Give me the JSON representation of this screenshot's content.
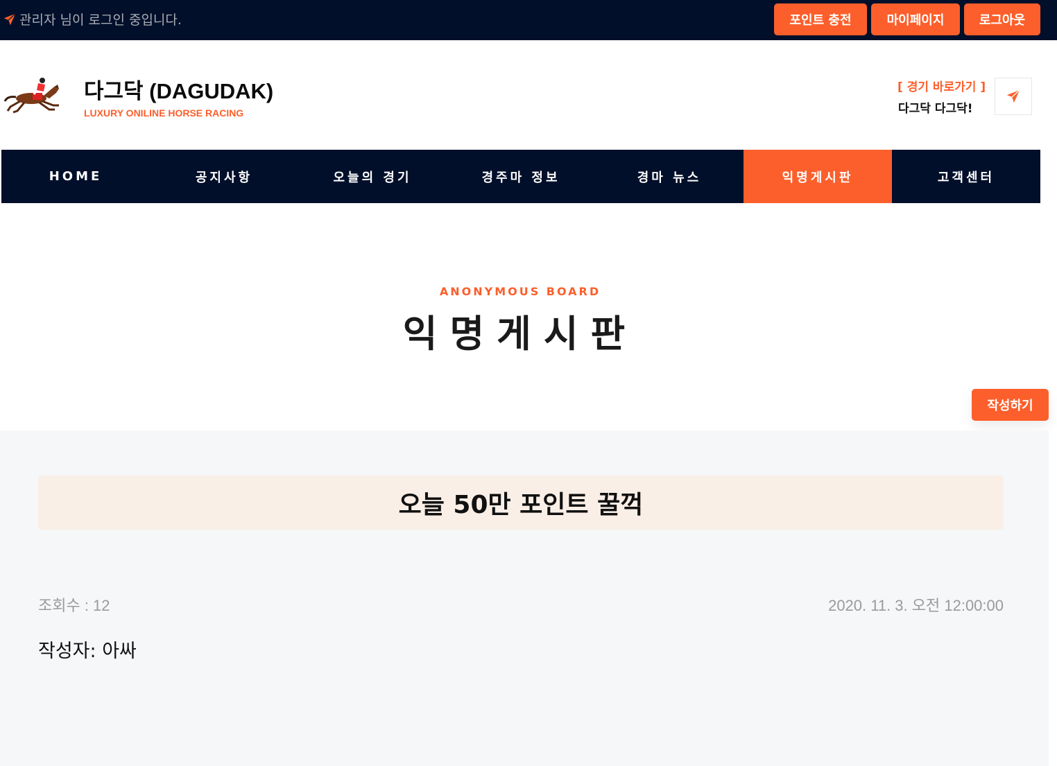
{
  "topbar": {
    "login_message": "관리자 님이 로그인 중입니다.",
    "buttons": [
      "포인트 충전",
      "마이페이지",
      "로그아웃"
    ]
  },
  "header": {
    "title": "다그닥 (DAGUDAK)",
    "subtitle": "LUXURY ONILINE HORSE RACING",
    "quick_label": "[ 경기 바로가기 ]",
    "quick_text": "다그닥 다그닥!"
  },
  "nav": {
    "items": [
      "HOME",
      "공지사항",
      "오늘의 경기",
      "경주마 정보",
      "경마 뉴스",
      "익명게시판",
      "고객센터"
    ],
    "active": "익명게시판"
  },
  "board": {
    "eyebrow": "ANONYMOUS BOARD",
    "title": "익명게시판",
    "write_button": "작성하기"
  },
  "post": {
    "title": "오늘 50만 포인트 꿀꺽",
    "views": "조회수 : 12",
    "date": "2020. 11. 3. 오전 12:00:00",
    "author": "작성자: 아싸"
  },
  "colors": {
    "accent": "#fc5f2b",
    "navy": "#020f2a",
    "post_bg": "#f6f7f9",
    "title_box_bg": "#faefe6"
  }
}
